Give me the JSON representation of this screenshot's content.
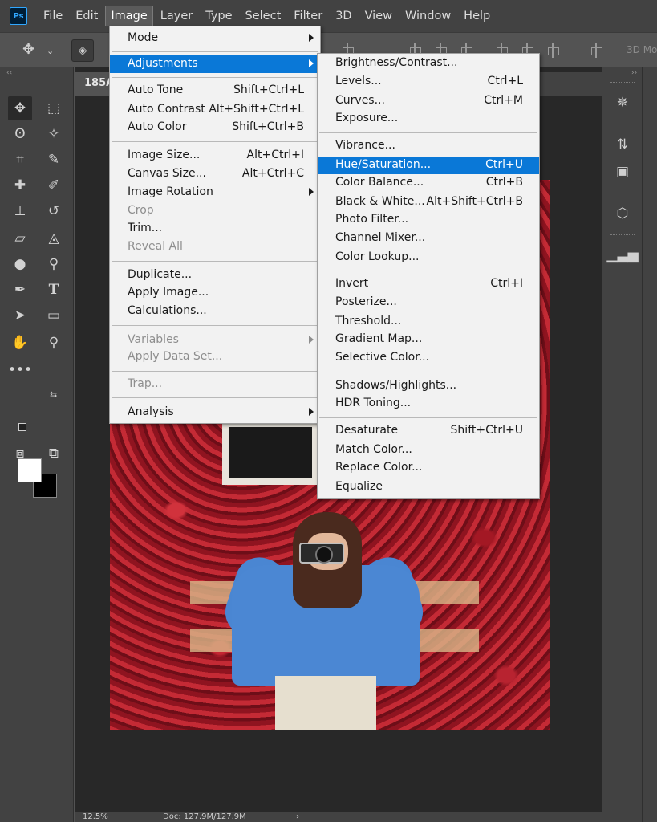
{
  "app": {
    "logo_text": "Ps"
  },
  "menubar": {
    "items": [
      "File",
      "Edit",
      "Image",
      "Layer",
      "Type",
      "Select",
      "Filter",
      "3D",
      "View",
      "Window",
      "Help"
    ],
    "active": "Image"
  },
  "optionsbar": {
    "mode_label": "3D Mo"
  },
  "document": {
    "tab_title": "185A",
    "zoom": "12.5%",
    "doc_info": "Doc: 127.9M/127.9M"
  },
  "image_menu": {
    "items": [
      {
        "label": "Mode",
        "shortcut": "",
        "submenu": true,
        "disabled": false
      },
      {
        "label": "Adjustments",
        "shortcut": "",
        "submenu": true,
        "disabled": false,
        "highlighted": true
      },
      {
        "label": "Auto Tone",
        "shortcut": "Shift+Ctrl+L",
        "submenu": false,
        "disabled": false
      },
      {
        "label": "Auto Contrast",
        "shortcut": "Alt+Shift+Ctrl+L",
        "submenu": false,
        "disabled": false
      },
      {
        "label": "Auto Color",
        "shortcut": "Shift+Ctrl+B",
        "submenu": false,
        "disabled": false
      },
      {
        "label": "Image Size...",
        "shortcut": "Alt+Ctrl+I",
        "submenu": false,
        "disabled": false
      },
      {
        "label": "Canvas Size...",
        "shortcut": "Alt+Ctrl+C",
        "submenu": false,
        "disabled": false
      },
      {
        "label": "Image Rotation",
        "shortcut": "",
        "submenu": true,
        "disabled": false
      },
      {
        "label": "Crop",
        "shortcut": "",
        "submenu": false,
        "disabled": true
      },
      {
        "label": "Trim...",
        "shortcut": "",
        "submenu": false,
        "disabled": false
      },
      {
        "label": "Reveal All",
        "shortcut": "",
        "submenu": false,
        "disabled": true
      },
      {
        "label": "Duplicate...",
        "shortcut": "",
        "submenu": false,
        "disabled": false
      },
      {
        "label": "Apply Image...",
        "shortcut": "",
        "submenu": false,
        "disabled": false
      },
      {
        "label": "Calculations...",
        "shortcut": "",
        "submenu": false,
        "disabled": false
      },
      {
        "label": "Variables",
        "shortcut": "",
        "submenu": true,
        "disabled": true
      },
      {
        "label": "Apply Data Set...",
        "shortcut": "",
        "submenu": false,
        "disabled": true
      },
      {
        "label": "Trap...",
        "shortcut": "",
        "submenu": false,
        "disabled": true
      },
      {
        "label": "Analysis",
        "shortcut": "",
        "submenu": true,
        "disabled": false
      }
    ]
  },
  "adjustments_menu": {
    "items": [
      {
        "label": "Brightness/Contrast...",
        "shortcut": ""
      },
      {
        "label": "Levels...",
        "shortcut": "Ctrl+L"
      },
      {
        "label": "Curves...",
        "shortcut": "Ctrl+M"
      },
      {
        "label": "Exposure...",
        "shortcut": ""
      },
      {
        "label": "Vibrance...",
        "shortcut": ""
      },
      {
        "label": "Hue/Saturation...",
        "shortcut": "Ctrl+U",
        "highlighted": true
      },
      {
        "label": "Color Balance...",
        "shortcut": "Ctrl+B"
      },
      {
        "label": "Black & White...",
        "shortcut": "Alt+Shift+Ctrl+B"
      },
      {
        "label": "Photo Filter...",
        "shortcut": ""
      },
      {
        "label": "Channel Mixer...",
        "shortcut": ""
      },
      {
        "label": "Color Lookup...",
        "shortcut": ""
      },
      {
        "label": "Invert",
        "shortcut": "Ctrl+I"
      },
      {
        "label": "Posterize...",
        "shortcut": ""
      },
      {
        "label": "Threshold...",
        "shortcut": ""
      },
      {
        "label": "Gradient Map...",
        "shortcut": ""
      },
      {
        "label": "Selective Color...",
        "shortcut": ""
      },
      {
        "label": "Shadows/Highlights...",
        "shortcut": ""
      },
      {
        "label": "HDR Toning...",
        "shortcut": ""
      },
      {
        "label": "Desaturate",
        "shortcut": "Shift+Ctrl+U"
      },
      {
        "label": "Match Color...",
        "shortcut": ""
      },
      {
        "label": "Replace Color...",
        "shortcut": ""
      },
      {
        "label": "Equalize",
        "shortcut": ""
      }
    ]
  },
  "colors": {
    "foreground": "#ffffff",
    "background": "#000000",
    "menu_highlight": "#0a78d7",
    "ps_blue": "#31a8ff"
  }
}
